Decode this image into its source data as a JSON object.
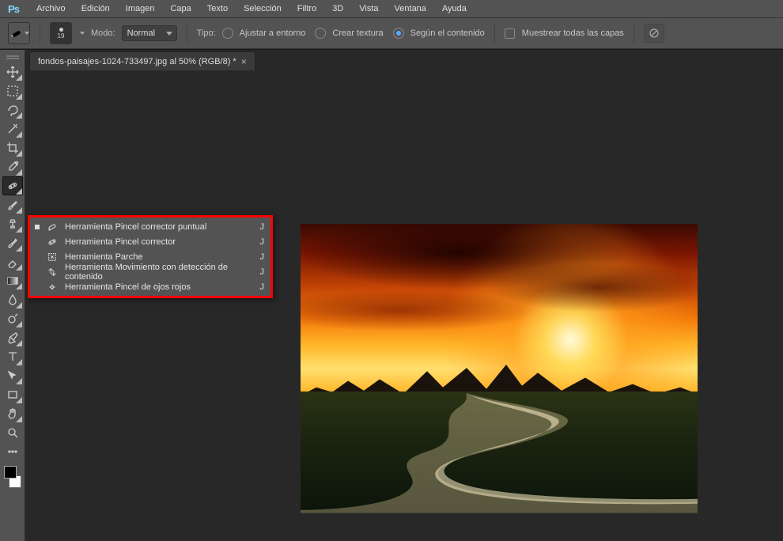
{
  "menubar": {
    "items": [
      "Archivo",
      "Edición",
      "Imagen",
      "Capa",
      "Texto",
      "Selección",
      "Filtro",
      "3D",
      "Vista",
      "Ventana",
      "Ayuda"
    ]
  },
  "options": {
    "brush_size": "19",
    "mode_label": "Modo:",
    "mode_value": "Normal",
    "type_label": "Tipo:",
    "radios": [
      {
        "label": "Ajustar a entorno",
        "checked": false
      },
      {
        "label": "Crear textura",
        "checked": false
      },
      {
        "label": "Según el contenido",
        "checked": true
      }
    ],
    "sample_all_label": "Muestrear todas las capas"
  },
  "document": {
    "tab_title": "fondos-paisajes-1024-733497.jpg al 50% (RGB/8) *"
  },
  "flyout": {
    "items": [
      {
        "label": "Herramienta Pincel corrector puntual",
        "shortcut": "J",
        "active": true,
        "icon": "bandage-dot"
      },
      {
        "label": "Herramienta Pincel corrector",
        "shortcut": "J",
        "active": false,
        "icon": "bandage"
      },
      {
        "label": "Herramienta Parche",
        "shortcut": "J",
        "active": false,
        "icon": "patch"
      },
      {
        "label": "Herramienta Movimiento con detección de contenido",
        "shortcut": "J",
        "active": false,
        "icon": "move-arrows"
      },
      {
        "label": "Herramienta Pincel de ojos rojos",
        "shortcut": "J",
        "active": false,
        "icon": "redeye"
      }
    ]
  },
  "tools": [
    {
      "name": "move-tool",
      "icon": "move",
      "fly": true
    },
    {
      "name": "marquee-tool",
      "icon": "marquee",
      "fly": true
    },
    {
      "name": "lasso-tool",
      "icon": "lasso",
      "fly": true
    },
    {
      "name": "magic-wand-tool",
      "icon": "wand",
      "fly": true
    },
    {
      "name": "crop-tool",
      "icon": "crop",
      "fly": true
    },
    {
      "name": "eyedropper-tool",
      "icon": "eyedrop",
      "fly": true
    },
    {
      "name": "spot-healing-tool",
      "icon": "bandage",
      "fly": true,
      "selected": true
    },
    {
      "name": "brush-tool",
      "icon": "brush",
      "fly": true
    },
    {
      "name": "clone-stamp-tool",
      "icon": "stamp",
      "fly": true
    },
    {
      "name": "history-brush-tool",
      "icon": "histbrush",
      "fly": true
    },
    {
      "name": "eraser-tool",
      "icon": "eraser",
      "fly": true
    },
    {
      "name": "gradient-tool",
      "icon": "gradient",
      "fly": true
    },
    {
      "name": "blur-tool",
      "icon": "blur",
      "fly": true
    },
    {
      "name": "dodge-tool",
      "icon": "dodge",
      "fly": true
    },
    {
      "name": "pen-tool",
      "icon": "pen",
      "fly": true
    },
    {
      "name": "type-tool",
      "icon": "type",
      "fly": true
    },
    {
      "name": "path-select-tool",
      "icon": "pathsel",
      "fly": true
    },
    {
      "name": "rectangle-tool",
      "icon": "rect",
      "fly": true
    },
    {
      "name": "hand-tool",
      "icon": "hand",
      "fly": true
    },
    {
      "name": "zoom-tool",
      "icon": "zoom",
      "fly": false
    },
    {
      "name": "edit-toolbar",
      "icon": "dots",
      "fly": false
    }
  ]
}
